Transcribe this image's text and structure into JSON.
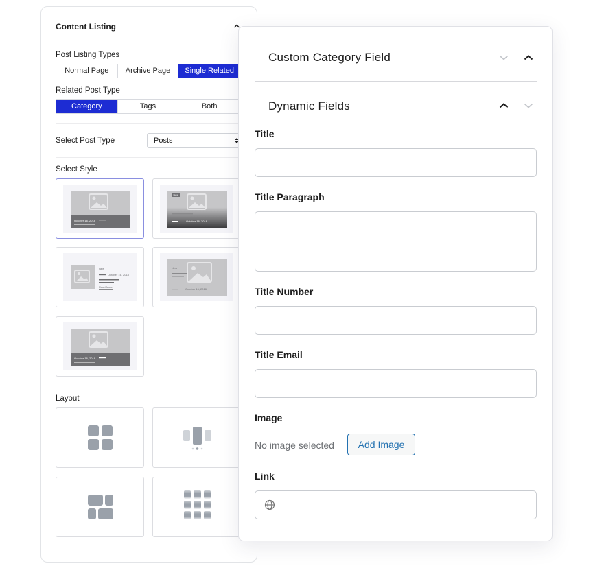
{
  "left_panel": {
    "title": "Content Listing",
    "post_listing_types": {
      "label": "Post Listing Types",
      "options": [
        "Normal Page",
        "Archive Page",
        "Single Related"
      ],
      "selected": "Single Related"
    },
    "related_post_type": {
      "label": "Related Post Type",
      "options": [
        "Category",
        "Tags",
        "Both"
      ],
      "selected": "Category"
    },
    "select_post_type": {
      "label": "Select Post Type",
      "value": "Posts"
    },
    "select_style": {
      "label": "Select Style",
      "thumb_date": "October 16, 2018",
      "thumb_badge": "New",
      "thumb_read_more": "Read More"
    },
    "layout": {
      "label": "Layout"
    }
  },
  "right_panel": {
    "custom_category_field": "Custom Category Field",
    "dynamic_fields": "Dynamic Fields",
    "fields": {
      "title": "Title",
      "title_paragraph": "Title Paragraph",
      "title_number": "Title Number",
      "title_email": "Title Email",
      "image": "Image",
      "link": "Link"
    },
    "no_image_text": "No image selected",
    "add_image_label": "Add Image"
  },
  "colors": {
    "accent_blue": "#1d2cd3",
    "wp_button_blue": "#2271b1"
  }
}
